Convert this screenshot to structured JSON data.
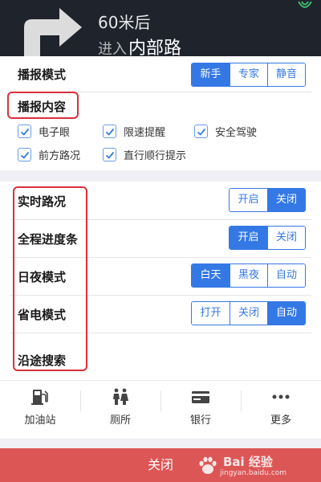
{
  "nav": {
    "distance": "60米后",
    "enter": "进入",
    "road": "内部路",
    "turn_icon": "turn-right-arrow-icon",
    "signal_icon": "gps-signal-icon"
  },
  "broadcast_mode": {
    "label": "播报模式",
    "options": [
      "新手",
      "专家",
      "静音"
    ],
    "selected": "新手"
  },
  "broadcast_content": {
    "label": "播报内容",
    "items": [
      {
        "label": "电子眼",
        "checked": true
      },
      {
        "label": "限速提醒",
        "checked": true
      },
      {
        "label": "安全驾驶",
        "checked": true
      },
      {
        "label": "前方路况",
        "checked": true
      },
      {
        "label": "直行顺行提示",
        "checked": true
      }
    ]
  },
  "settings": [
    {
      "label": "实时路况",
      "options": [
        "开启",
        "关闭"
      ],
      "selected": "关闭"
    },
    {
      "label": "全程进度条",
      "options": [
        "开启",
        "关闭"
      ],
      "selected": "开启"
    },
    {
      "label": "日夜模式",
      "options": [
        "白天",
        "黑夜",
        "自动"
      ],
      "selected": "白天"
    },
    {
      "label": "省电模式",
      "options": [
        "打开",
        "关闭",
        "自动"
      ],
      "selected": "自动"
    },
    {
      "label": "沿途搜索"
    }
  ],
  "categories": [
    {
      "label": "加油站",
      "icon": "gas-station-icon"
    },
    {
      "label": "厕所",
      "icon": "restroom-icon"
    },
    {
      "label": "银行",
      "icon": "bank-card-icon"
    },
    {
      "label": "更多",
      "icon": "more-dots-icon"
    }
  ],
  "close_button": "关闭",
  "watermark": {
    "main": "Bai 经验",
    "url": "jingyan.baidu.com"
  },
  "colors": {
    "accent": "#3478e5",
    "annotation": "#d9313d",
    "close_bar": "#dd5656",
    "nav_bg": "#1f232c"
  }
}
